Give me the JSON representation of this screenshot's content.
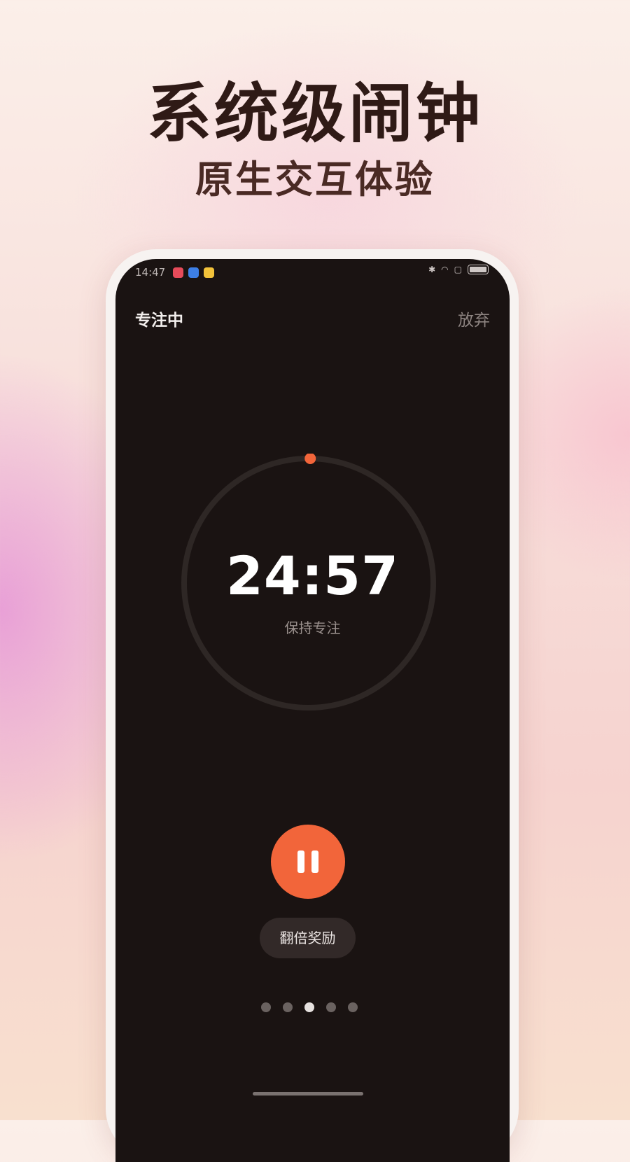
{
  "hero": {
    "title": "系统级闹钟",
    "subtitle": "原生交互体验"
  },
  "status_bar": {
    "time": "14:47",
    "app_icons": [
      "video-app-icon",
      "cloud-app-icon",
      "heart-app-icon"
    ],
    "indicators": [
      "bluetooth-icon",
      "wifi-icon",
      "screenshot-icon",
      "battery-icon"
    ]
  },
  "header": {
    "title": "专注中",
    "abandon_label": "放弃"
  },
  "timer": {
    "value": "24:57",
    "caption": "保持专注",
    "progress_fraction": 0.002
  },
  "controls": {
    "pause_icon": "pause-icon",
    "double_reward_label": "翻倍奖励"
  },
  "pager": {
    "count": 5,
    "active_index": 2
  },
  "colors": {
    "accent": "#f2653a",
    "screen_bg": "#1a1312",
    "ring_track": "#2e2725"
  }
}
